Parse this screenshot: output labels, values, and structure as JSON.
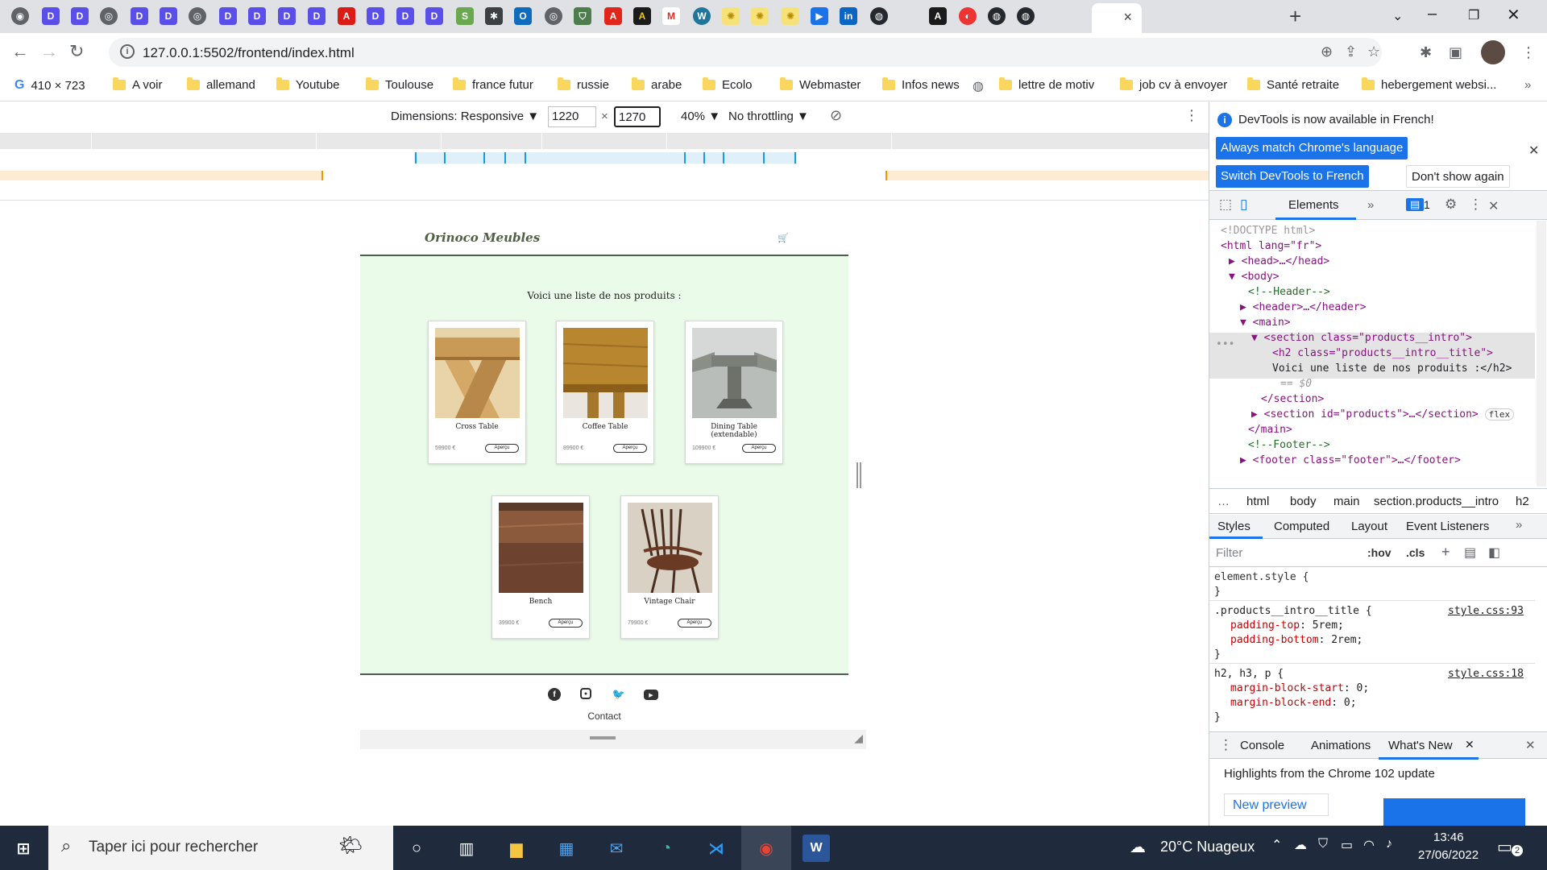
{
  "browser": {
    "active_tab_close": "×",
    "new_tab": "+",
    "url": "127.0.0.1:5502/frontend/index.html",
    "bookmarks": [
      "410 × 723",
      "A voir",
      "allemand",
      "Youtube",
      "Toulouse",
      "france futur",
      "russie",
      "arabe",
      "Ecolo",
      "Webmaster",
      "Infos news",
      "lettre de motiv",
      "job cv à envoyer",
      "Santé retraite",
      "hebergement websi..."
    ]
  },
  "device_toolbar": {
    "dimensions_label": "Dimensions: Responsive ▼",
    "width": "1220",
    "height": "1270",
    "zoom": "40% ▼",
    "throttling": "No throttling ▼"
  },
  "site": {
    "brand": "Orinoco Meubles",
    "cart_icon": "🛒",
    "intro": "Voici une liste de nos produits :",
    "products": [
      {
        "name": "Cross Table",
        "price": "59900 €",
        "button": "Aperçu"
      },
      {
        "name": "Coffee Table",
        "price": "89900 €",
        "button": "Aperçu"
      },
      {
        "name": "Dining Table (extendable)",
        "price": "109900 €",
        "button": "Aperçu"
      },
      {
        "name": "Bench",
        "price": "39900 €",
        "button": "Aperçu"
      },
      {
        "name": "Vintage Chair",
        "price": "79900 €",
        "button": "Aperçu"
      }
    ],
    "footer_contact": "Contact"
  },
  "devtools": {
    "banner_text": "DevTools is now available in French!",
    "btn_match": "Always match Chrome's language",
    "btn_switch": "Switch DevTools to French",
    "btn_dont_show": "Don't show again",
    "tab_elements": "Elements",
    "issues_count": "1",
    "dom": {
      "doctype": "<!DOCTYPE html>",
      "html_open": "<html lang=\"fr\">",
      "head": "<head>…</head>",
      "body_open": "<body>",
      "c_header": "<!--Header-->",
      "header": "<header>…</header>",
      "main_open": "<main>",
      "section_open": "<section class=\"products__intro\">",
      "h2_open": "<h2 class=\"products__intro__title\">",
      "h2_text": "Voici une liste de nos produits :</h2>",
      "h2_eq": "== $0",
      "section_close": "</section>",
      "section_products": "<section id=\"products\">…</section>",
      "flex_badge": "flex",
      "main_close": "</main>",
      "c_footer": "<!--Footer-->",
      "footer": "<footer class=\"footer\">…</footer>"
    },
    "breadcrumbs": [
      "…",
      "html",
      "body",
      "main",
      "section.products__intro",
      "h2"
    ],
    "sub_tabs": [
      "Styles",
      "Computed",
      "Layout",
      "Event Listeners"
    ],
    "filter_placeholder": "Filter",
    "hov": ":hov",
    "cls": ".cls",
    "styles": {
      "element_style": "element.style {",
      "close": "}",
      "rule1_selector": ".products__intro__title {",
      "rule1_source": "style.css:93",
      "rule1_p1": "padding-top",
      "rule1_v1": "5rem;",
      "rule1_p2": "padding-bottom",
      "rule1_v2": "2rem;",
      "rule2_selector": "h2, h3, p {",
      "rule2_source": "style.css:18",
      "rule2_p1": "margin-block-start",
      "rule2_v1": "0;",
      "rule2_p2": "margin-block-end",
      "rule2_v2": "0;"
    },
    "drawer_tabs": [
      "Console",
      "Animations",
      "What's New"
    ],
    "drawer_highlight": "Highlights from the Chrome 102 update",
    "new_preview": "New preview"
  },
  "taskbar": {
    "search_placeholder": "Taper ici pour rechercher",
    "weather": "20°C  Nuageux",
    "time": "13:46",
    "date": "27/06/2022",
    "notif_count": "2"
  },
  "colors": {
    "page_bg": "#eafbea",
    "brand_green": "#4f5f43",
    "devtools_blue": "#1a73e8",
    "taskbar": "#1f2b3d"
  }
}
